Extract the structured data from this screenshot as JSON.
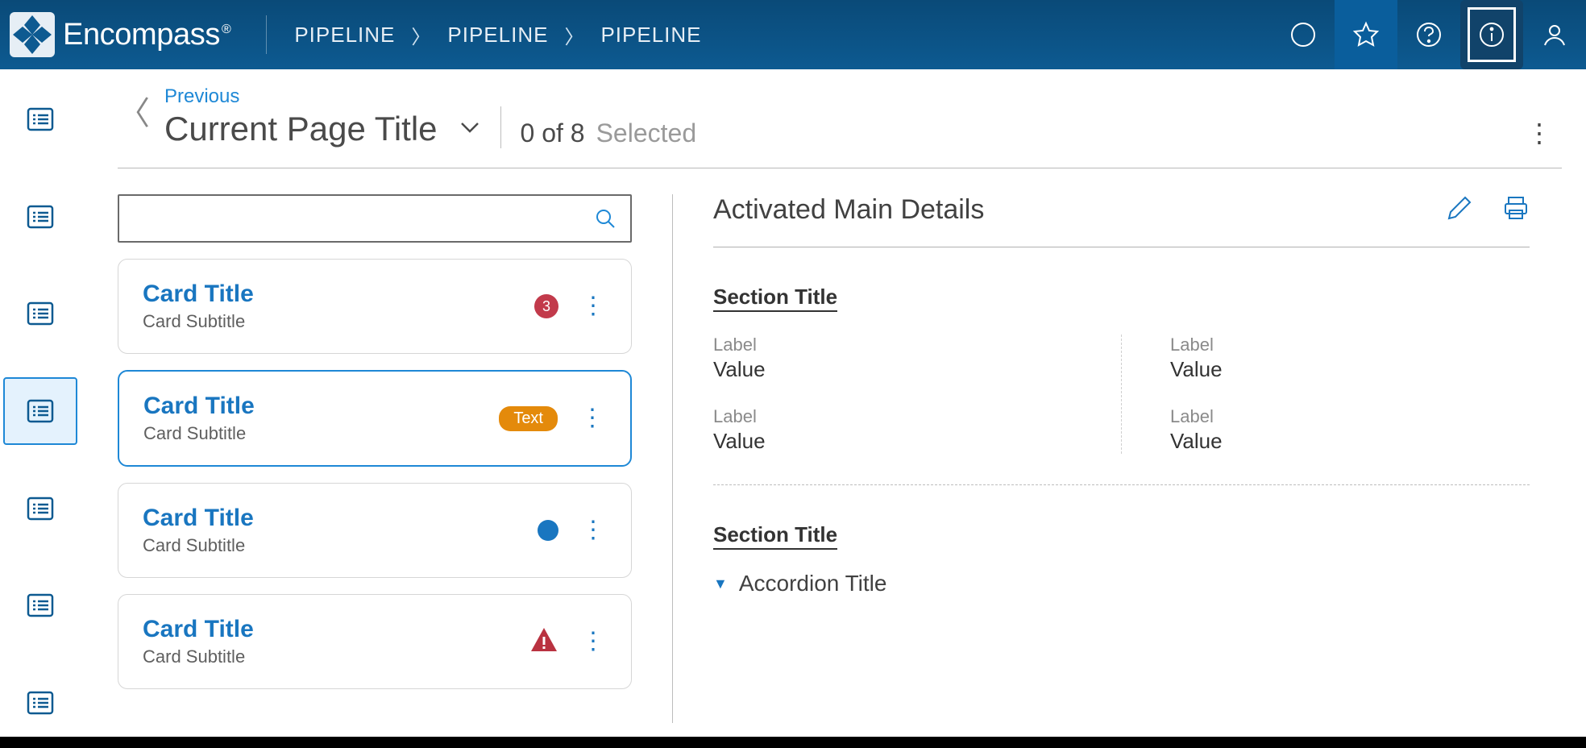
{
  "brand": "Encompass",
  "breadcrumbs": [
    "PIPELINE",
    "PIPELINE",
    "PIPELINE"
  ],
  "header": {
    "previous": "Previous",
    "page_title": "Current Page Title",
    "count_text": "0 of 8",
    "selected_label": "Selected"
  },
  "search": {
    "placeholder": ""
  },
  "cards": [
    {
      "title": "Card Title",
      "subtitle": "Card Subtitle",
      "indicator": "count",
      "indicator_value": "3",
      "selected": false
    },
    {
      "title": "Card Title",
      "subtitle": "Card Subtitle",
      "indicator": "pill",
      "indicator_value": "Text",
      "selected": true
    },
    {
      "title": "Card Title",
      "subtitle": "Card Subtitle",
      "indicator": "dot",
      "indicator_value": "",
      "selected": false
    },
    {
      "title": "Card Title",
      "subtitle": "Card Subtitle",
      "indicator": "warn",
      "indicator_value": "",
      "selected": false
    }
  ],
  "details": {
    "title": "Activated Main Details",
    "section1": {
      "title": "Section Title",
      "fields": [
        {
          "label": "Label",
          "value": "Value"
        },
        {
          "label": "Label",
          "value": "Value"
        },
        {
          "label": "Label",
          "value": "Value"
        },
        {
          "label": "Label",
          "value": "Value"
        }
      ]
    },
    "section2": {
      "title": "Section Title",
      "accordion": "Accordion Title"
    }
  },
  "sidenav": {
    "active_index": 3,
    "count": 7
  }
}
